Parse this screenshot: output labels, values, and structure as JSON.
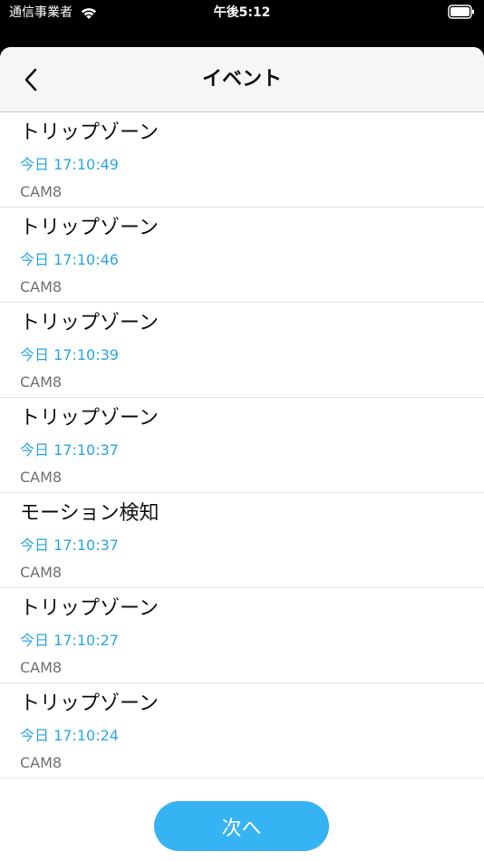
{
  "status_bar": {
    "carrier": "通信事業者",
    "time": "午後5:12",
    "wifi_icon": "wifi-icon",
    "battery_icon": "battery-icon"
  },
  "nav": {
    "back_icon": "chevron-left-icon",
    "title": "イベント"
  },
  "events": [
    {
      "title": "トリップゾーン",
      "time": "今日 17:10:49",
      "camera": "CAM8"
    },
    {
      "title": "トリップゾーン",
      "time": "今日 17:10:46",
      "camera": "CAM8"
    },
    {
      "title": "トリップゾーン",
      "time": "今日 17:10:39",
      "camera": "CAM8"
    },
    {
      "title": "トリップゾーン",
      "time": "今日 17:10:37",
      "camera": "CAM8"
    },
    {
      "title": "モーション検知",
      "time": "今日 17:10:37",
      "camera": "CAM8"
    },
    {
      "title": "トリップゾーン",
      "time": "今日 17:10:27",
      "camera": "CAM8"
    },
    {
      "title": "トリップゾーン",
      "time": "今日 17:10:24",
      "camera": "CAM8"
    }
  ],
  "footer": {
    "next_label": "次へ"
  },
  "colors": {
    "accent": "#36b3f2",
    "time_text": "#2aa6e8",
    "secondary_text": "#707070"
  }
}
